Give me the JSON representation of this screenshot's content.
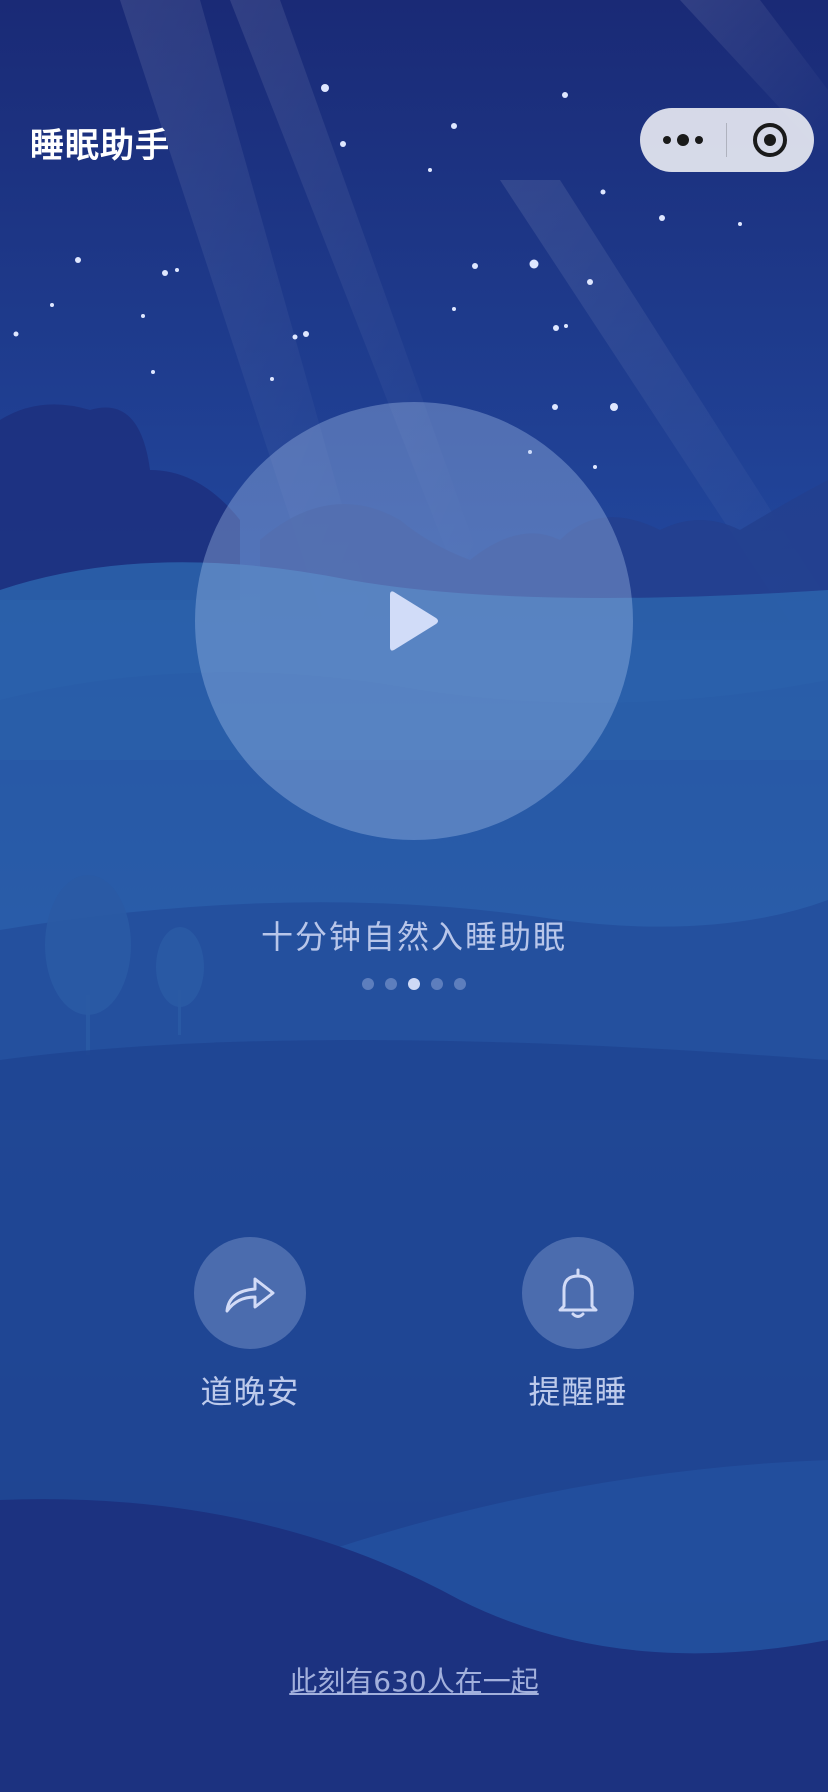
{
  "header": {
    "title": "睡眠助手"
  },
  "capsule": {
    "more_icon": "more-dots-icon",
    "close_icon": "target-circle-icon"
  },
  "player": {
    "play_icon": "play-icon",
    "subtitle": "十分钟自然入睡助眠",
    "pagination": {
      "total": 5,
      "active_index": 2
    }
  },
  "actions": [
    {
      "label": "道晚安",
      "icon": "share-arrow-icon"
    },
    {
      "label": "提醒睡",
      "icon": "bell-icon"
    }
  ],
  "footer": {
    "together_text": "此刻有630人在一起"
  },
  "colors": {
    "sky_top": "#1b2a78",
    "sky_mid": "#2551a5",
    "hill": "#1e3f8e",
    "text": "#e1e8ff"
  }
}
